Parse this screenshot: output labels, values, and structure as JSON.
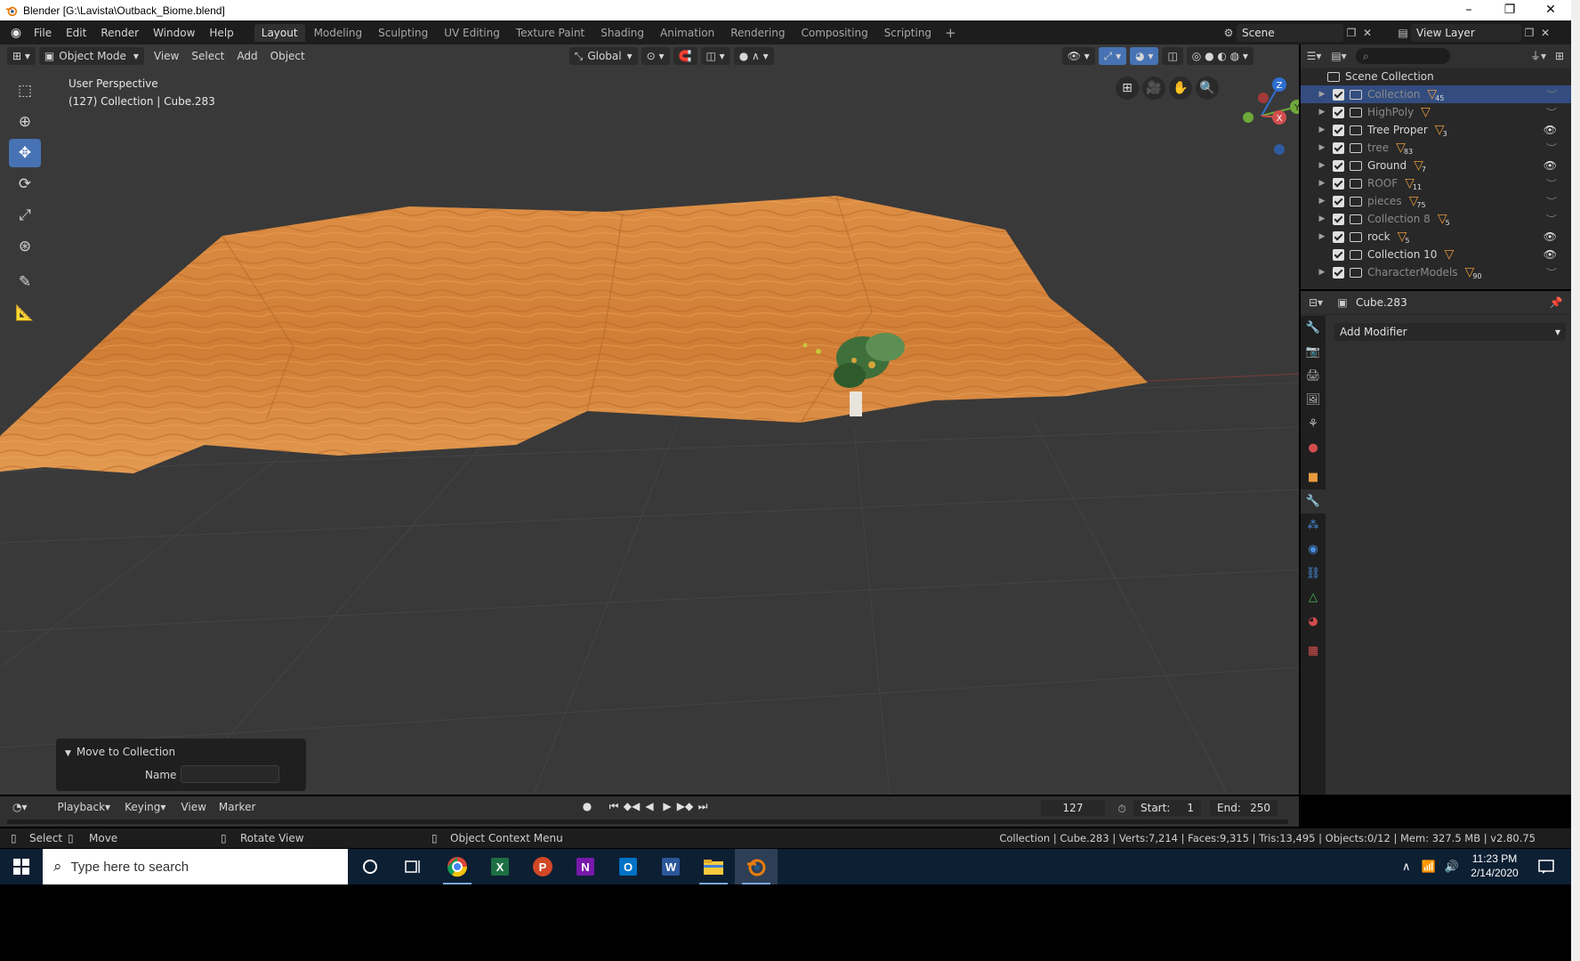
{
  "window": {
    "title": "Blender [G:\\Lavista\\Outback_Biome.blend]",
    "controls": [
      "–",
      "❐",
      "✕"
    ]
  },
  "menubar": {
    "items": [
      "File",
      "Edit",
      "Render",
      "Window",
      "Help"
    ],
    "workspaces": [
      "Layout",
      "Modeling",
      "Sculpting",
      "UV Editing",
      "Texture Paint",
      "Shading",
      "Animation",
      "Rendering",
      "Compositing",
      "Scripting"
    ],
    "active_workspace": "Layout",
    "scene": "Scene",
    "view_layer": "View Layer"
  },
  "viewport": {
    "mode": "Object Mode",
    "menus": [
      "View",
      "Select",
      "Add",
      "Object"
    ],
    "transform_orientation": "Global",
    "perspective_label": "User Perspective",
    "context_label": "(127) Collection | Cube.283",
    "gizmo_axes": [
      "Z",
      "Y",
      "X"
    ]
  },
  "redo_panel": {
    "title": "Move to Collection",
    "name_label": "Name",
    "name_value": ""
  },
  "outliner": {
    "root": "Scene Collection",
    "items": [
      {
        "name": "Collection",
        "count": "45",
        "selected": true,
        "visible": false,
        "dim": true,
        "expander": true
      },
      {
        "name": "HighPoly",
        "count": "",
        "selected": false,
        "visible": false,
        "dim": true,
        "expander": true
      },
      {
        "name": "Tree Proper",
        "count": "3",
        "selected": false,
        "visible": true,
        "dim": false,
        "expander": true
      },
      {
        "name": "tree",
        "count": "83",
        "selected": false,
        "visible": false,
        "dim": true,
        "expander": true
      },
      {
        "name": "Ground",
        "count": "7",
        "selected": false,
        "visible": true,
        "dim": false,
        "expander": true
      },
      {
        "name": "ROOF",
        "count": "11",
        "selected": false,
        "visible": false,
        "dim": true,
        "expander": true
      },
      {
        "name": "pieces",
        "count": "75",
        "selected": false,
        "visible": false,
        "dim": true,
        "expander": true
      },
      {
        "name": "Collection 8",
        "count": "5",
        "selected": false,
        "visible": false,
        "dim": true,
        "expander": true
      },
      {
        "name": "rock",
        "count": "5",
        "selected": false,
        "visible": true,
        "dim": false,
        "expander": true
      },
      {
        "name": "Collection 10",
        "count": "",
        "selected": false,
        "visible": true,
        "dim": false,
        "expander": false
      },
      {
        "name": "CharacterModels",
        "count": "90",
        "selected": false,
        "visible": false,
        "dim": true,
        "expander": true
      }
    ]
  },
  "properties": {
    "object_name": "Cube.283",
    "add_modifier": "Add Modifier"
  },
  "timeline": {
    "menus": [
      "Playback",
      "Keying",
      "View",
      "Marker"
    ],
    "current_frame": "127",
    "start_label": "Start:",
    "start_value": "1",
    "end_label": "End:",
    "end_value": "250"
  },
  "statusbar": {
    "select": "Select",
    "move": "Move",
    "rotate": "Rotate View",
    "context_menu": "Object Context Menu",
    "stats": "Collection | Cube.283 | Verts:7,214 | Faces:9,315 | Tris:13,495 | Objects:0/12 | Mem: 327.5 MB | v2.80.75"
  },
  "taskbar": {
    "search_placeholder": "Type here to search",
    "time": "11:23 PM",
    "date": "2/14/2020"
  },
  "colors": {
    "accent": "#4772b3",
    "selection": "#334d80",
    "terrain": "#d98a3c",
    "viewport_bg": "#393939"
  }
}
